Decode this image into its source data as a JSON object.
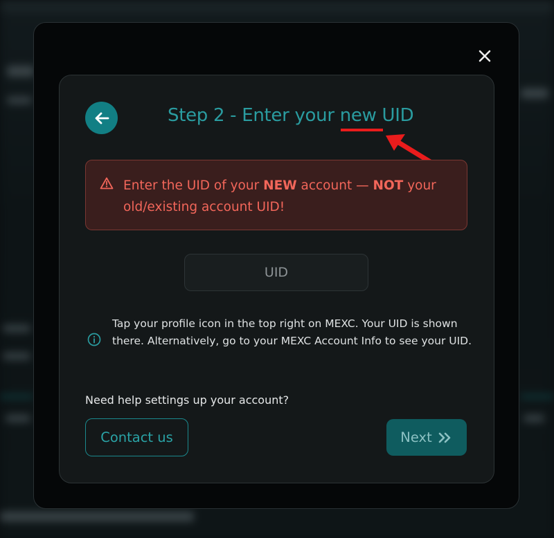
{
  "modal": {
    "close_icon": "close-icon",
    "title_prefix": "Step 2 - Enter your ",
    "title_emphasis": "new",
    "title_suffix": " UID",
    "back_icon": "arrow-left-icon",
    "warning": {
      "icon": "warning-triangle-icon",
      "part1": "Enter the UID of your ",
      "bold1": "NEW",
      "part2": " account — ",
      "bold2": "NOT",
      "part3": " your old/existing account UID!"
    },
    "uid_input": {
      "placeholder": "UID",
      "value": ""
    },
    "info": {
      "icon": "info-icon",
      "text": "Tap your profile icon in the top right on MEXC. Your UID is shown there. Alternatively, go to your MEXC Account Info to see your UID."
    },
    "help_text": "Need help settings up your account?",
    "contact_label": "Contact us",
    "next_label": "Next",
    "next_icon": "double-chevron-right-icon"
  },
  "colors": {
    "accent": "#127f84",
    "title": "#2a9ca0",
    "warning_text": "#f2665a",
    "warning_bg": "#3a1e1d",
    "annotation_red": "#ea1c1c"
  }
}
